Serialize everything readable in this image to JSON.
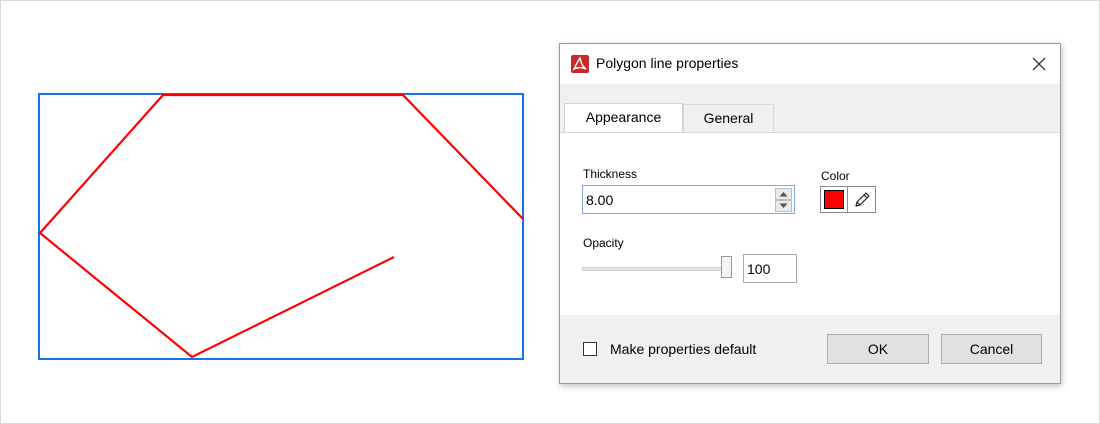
{
  "dialog": {
    "title": "Polygon line properties",
    "tabs": [
      {
        "label": "Appearance",
        "active": true
      },
      {
        "label": "General",
        "active": false
      }
    ],
    "thickness": {
      "label": "Thickness",
      "value": "8.00"
    },
    "color": {
      "label": "Color",
      "value": "#ff0000"
    },
    "opacity": {
      "label": "Opacity",
      "value": "100",
      "level_percent": 100
    },
    "make_default": {
      "label": "Make properties default",
      "checked": false
    },
    "ok_label": "OK",
    "cancel_label": "Cancel"
  },
  "canvas": {
    "bounding_box_color": "#1a73e8",
    "polyline_color": "#ff0000"
  },
  "icons": {
    "app": "pdf-app-icon",
    "close": "close-icon",
    "spin_up": "chevron-up-icon",
    "spin_down": "chevron-down-icon",
    "edit_color": "pencil-icon"
  }
}
